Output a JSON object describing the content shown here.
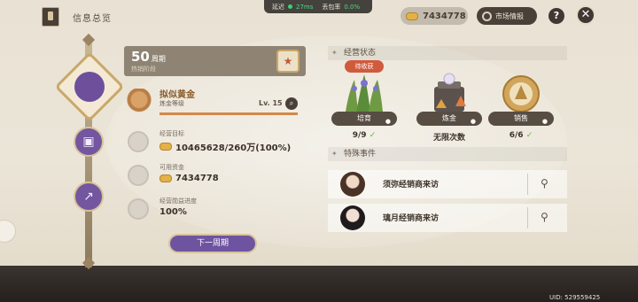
{
  "header": {
    "title": "信息总览",
    "network": {
      "latency_label": "延迟",
      "latency_value": "27ms",
      "loss_label": "丢包率",
      "loss_value": "0.0%"
    },
    "coins": "7434778",
    "market_label": "市场情报",
    "help_label": "?",
    "close_label": "✕"
  },
  "period": {
    "number": "50",
    "unit": "周期",
    "stage": "热销阶段"
  },
  "rank": {
    "title": "拟似黄金",
    "subtitle": "炼金等级",
    "level": "Lv. 15",
    "progress": 1.0
  },
  "stats": [
    {
      "label": "经营目标",
      "value": "10465628/260万(100%)"
    },
    {
      "label": "可用资金",
      "value": "7434778"
    },
    {
      "label": "经营勋益进度",
      "value": "100%"
    }
  ],
  "next_button": "下一周期",
  "status_section": {
    "title": "经营状态",
    "items": [
      {
        "label": "培育",
        "status": "9/9",
        "check": true,
        "tag": "待收获"
      },
      {
        "label": "炼金",
        "status": "无限次数",
        "check": false
      },
      {
        "label": "销售",
        "status": "6/6",
        "check": true
      }
    ]
  },
  "events_section": {
    "title": "特殊事件",
    "events": [
      {
        "text": "须弥经销商来访"
      },
      {
        "text": "璃月经销商来访"
      }
    ]
  },
  "uid": "UID: 529559425",
  "colors": {
    "accent_purple": "#6e53a0",
    "check_green": "#6cae4e",
    "tag_red": "#d05a3c"
  }
}
